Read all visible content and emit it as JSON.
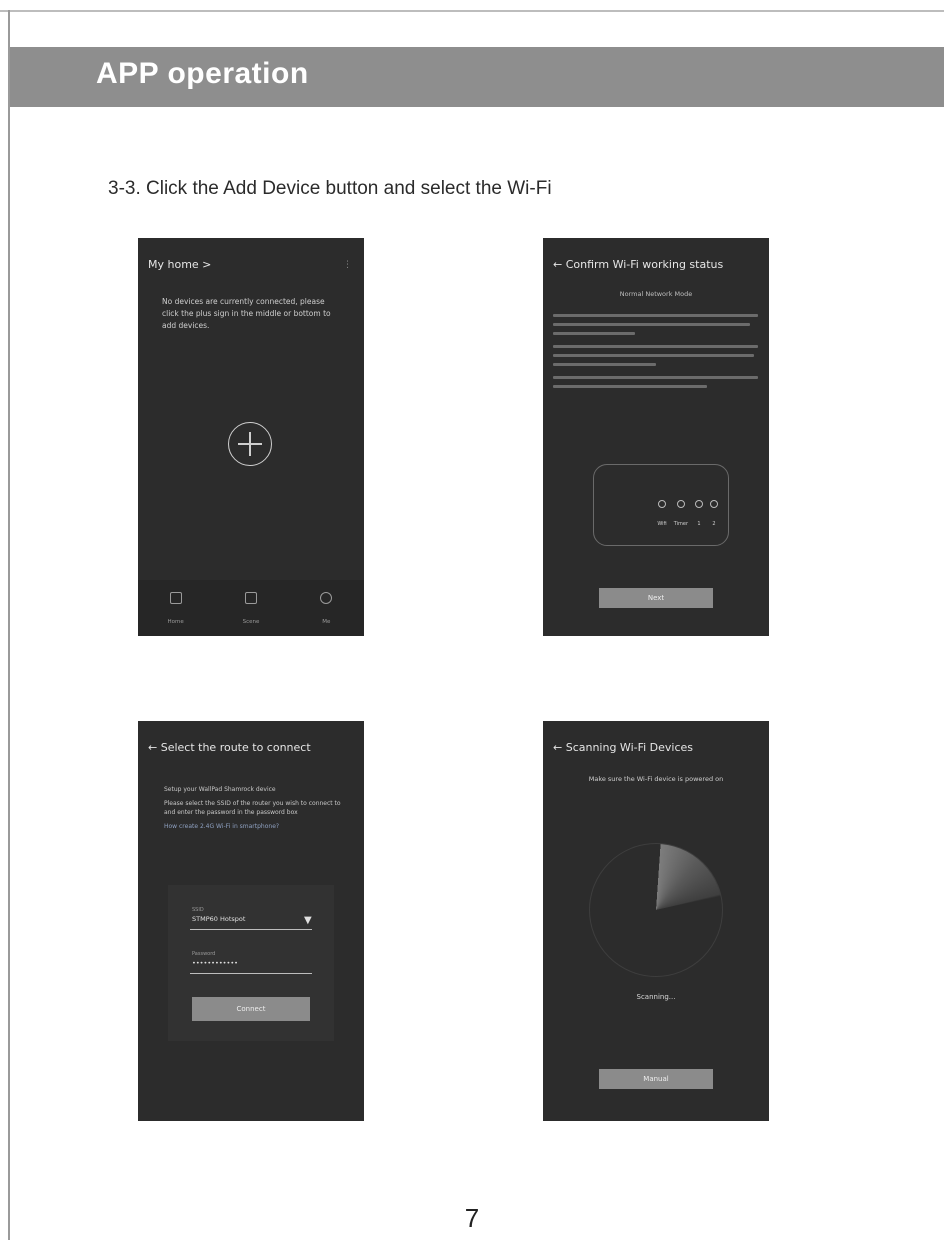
{
  "section_title": "APP operation",
  "step_text": "3-3. Click the Add  Device button and select the Wi-Fi",
  "page_number": "7",
  "phone1": {
    "header": "My home  >",
    "menu_glyph": "⋮",
    "message": "No devices are currently connected, please click the plus sign in the middle or bottom to add devices.",
    "tabs": [
      {
        "label": "Home",
        "icon": "home-icon"
      },
      {
        "label": "Scene",
        "icon": "scene-icon"
      },
      {
        "label": "Me",
        "icon": "profile-icon"
      }
    ]
  },
  "phone2": {
    "header": "←  Confirm Wi-Fi working status",
    "subtitle": "Normal Network Mode",
    "leds": [
      "Wifi",
      "Timer",
      "1",
      "2"
    ],
    "button": "Next"
  },
  "phone3": {
    "header": "←  Select the route to connect",
    "lines": [
      "Setup your WallPad Shamrock device",
      "Please select the SSID of the router you wish to connect to and enter the password in the password box",
      "How create 2.4G Wi-Fi in smartphone?"
    ],
    "ssid_label": "SSID",
    "ssid_value": "STMP60 Hotspot",
    "password_label": "Password",
    "password_value": "••••••••••••",
    "button": "Connect"
  },
  "phone4": {
    "header": "←  Scanning Wi-Fi Devices",
    "message": "Make sure the Wi-Fi device is powered on",
    "status": "Scanning...",
    "button": "Manual"
  }
}
